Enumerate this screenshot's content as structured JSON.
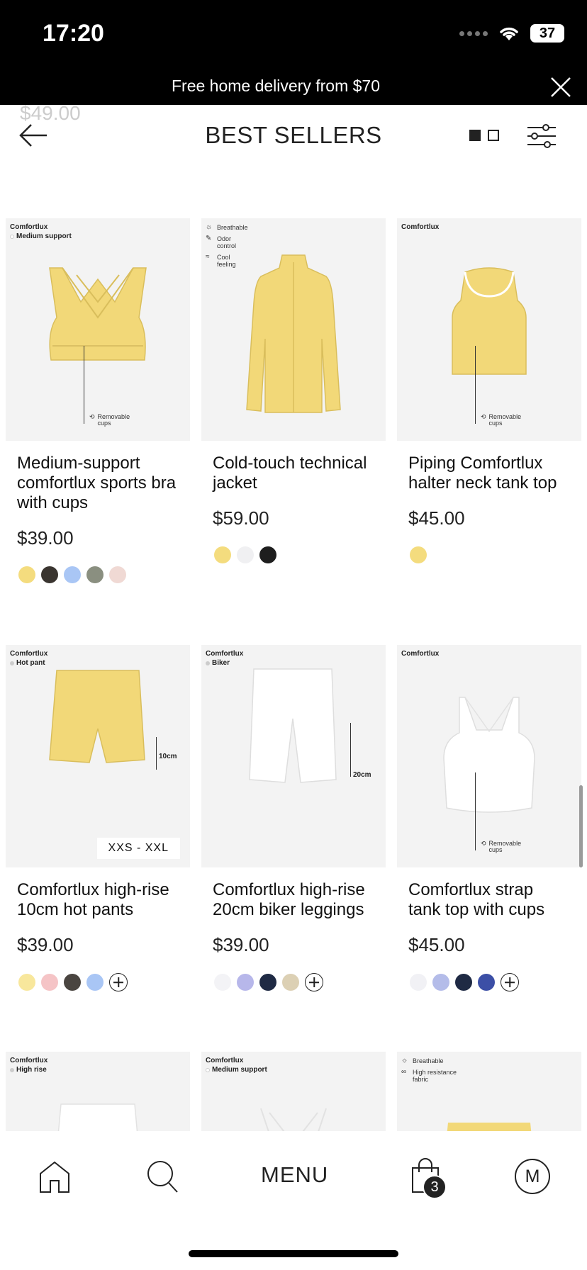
{
  "status": {
    "time": "17:20",
    "battery": "37"
  },
  "promo": {
    "text": "Free home delivery from $70"
  },
  "header": {
    "title": "BEST SELLERS",
    "ghost_price": "$49.00"
  },
  "products": [
    {
      "name": "Medium-support comfortlux sports bra with cups",
      "price": "$39.00",
      "brand": "Comfortlux",
      "support": "Medium support",
      "callout": "Removable cups",
      "swatches": [
        "#f4dc7e",
        "#3a3530",
        "#a9c6f5",
        "#8a8f80",
        "#f0d9d4"
      ]
    },
    {
      "name": "Cold-touch technical jacket",
      "price": "$59.00",
      "features": [
        "Breathable",
        "Odor control",
        "Cool feeling"
      ],
      "swatches": [
        "#f4dc7e",
        "#f0f0f2",
        "#1e1e1e"
      ]
    },
    {
      "name": "Piping Comfortlux halter neck tank top",
      "price": "$45.00",
      "brand": "Comfortlux",
      "callout": "Removable cups",
      "swatches": [
        "#f4dc7e"
      ]
    },
    {
      "name": "Comfortlux high-rise 10cm hot pants",
      "price": "$39.00",
      "brand": "Comfortlux",
      "support": "Hot pant",
      "measure": "10cm",
      "size_range": "XXS - XXL",
      "swatches": [
        "#f8e79c",
        "#f5c4c6",
        "#4a4540",
        "#a9c6f5"
      ]
    },
    {
      "name": "Comfortlux high-rise 20cm biker leggings",
      "price": "$39.00",
      "brand": "Comfortlux",
      "support": "Biker",
      "measure": "20cm",
      "swatches": [
        "#f3f3f6",
        "#b7b7ea",
        "#1f2a44",
        "#dcd0b4"
      ]
    },
    {
      "name": "Comfortlux strap tank top with cups",
      "price": "$45.00",
      "brand": "Comfortlux",
      "callout": "Removable cups",
      "swatches": [
        "#f1f1f5",
        "#b4bce9",
        "#1f2a44",
        "#3c4fa6"
      ]
    },
    {
      "brand": "Comfortlux",
      "support": "High rise"
    },
    {
      "brand": "Comfortlux",
      "support": "Medium support"
    },
    {
      "features": [
        "Breathable",
        "High resistance fabric"
      ]
    }
  ],
  "nav": {
    "menu": "MENU",
    "bag_count": "3",
    "account_initial": "M"
  },
  "colors": {
    "bar": "#000000",
    "text": "#111111",
    "image_bg": "#f3f3f3",
    "product_yellow": "#f4dc7e"
  }
}
